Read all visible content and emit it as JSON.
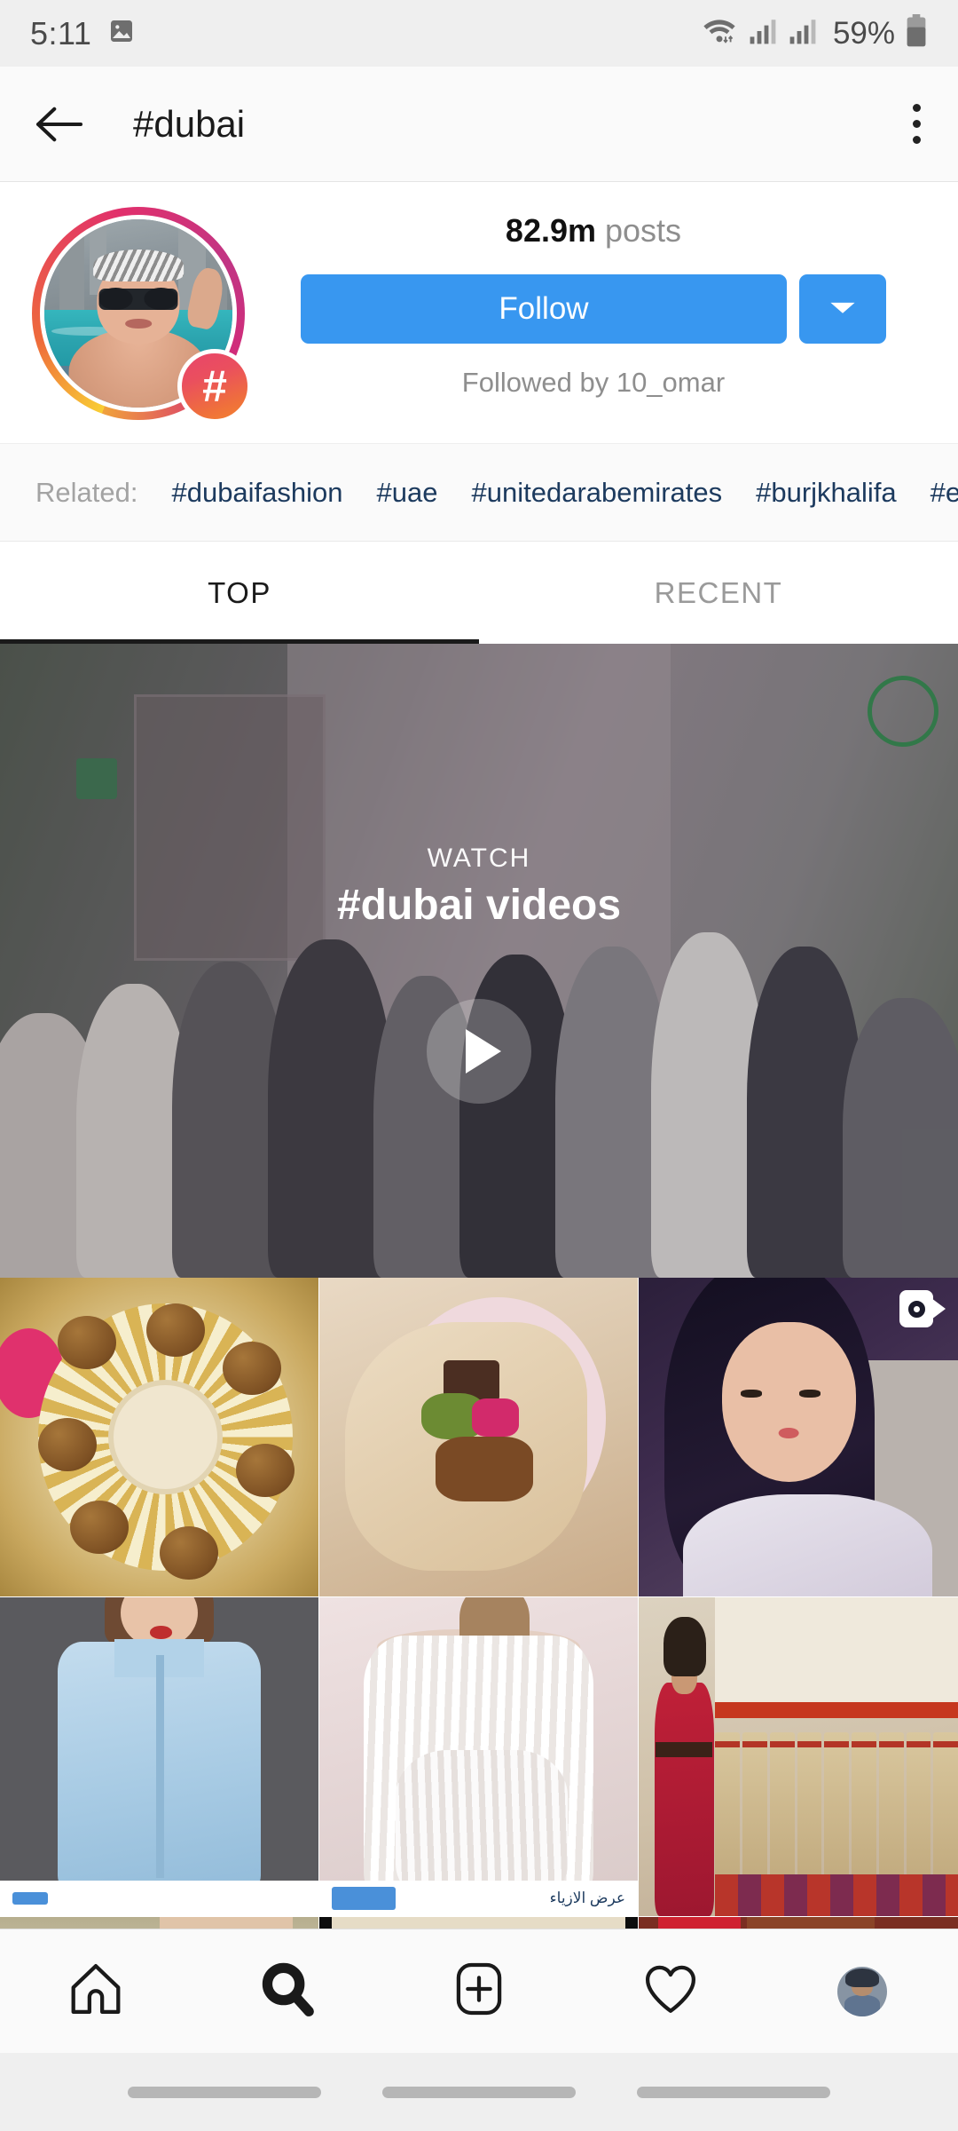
{
  "status_bar": {
    "time": "5:11",
    "battery_percent": "59%",
    "icons": [
      "image-icon",
      "wifi-icon",
      "signal-icon",
      "signal-icon",
      "battery-icon"
    ]
  },
  "header": {
    "title": "#dubai",
    "back_icon": "back-arrow-icon",
    "menu_icon": "kebab-menu-icon"
  },
  "profile": {
    "posts_count": "82.9m",
    "posts_label": "posts",
    "follow_label": "Follow",
    "dropdown_icon": "chevron-down-icon",
    "followed_by": "Followed by 10_omar",
    "hashtag_badge": "#",
    "accent_color": "#3897f0"
  },
  "related": {
    "label": "Related:",
    "tags": [
      "#dubaifashion",
      "#uae",
      "#unitedarabemirates",
      "#burjkhalifa",
      "#emirates",
      "#"
    ]
  },
  "tabs": {
    "items": [
      {
        "label": "TOP",
        "active": true
      },
      {
        "label": "RECENT",
        "active": false
      }
    ]
  },
  "video_banner": {
    "eyebrow": "WATCH",
    "title": "#dubai videos",
    "play_icon": "play-icon"
  },
  "grid": {
    "row1": [
      {
        "alt": "falafel-plate-with-tahini",
        "badge": null
      },
      {
        "alt": "shawarma-wrap-on-plate",
        "badge": null
      },
      {
        "alt": "woman-dark-hair-portrait",
        "badge": "video-camera-icon"
      }
    ],
    "row2": [
      {
        "alt": "model-in-blue-shirt",
        "badge": null
      },
      {
        "alt": "white-draped-dress",
        "badge": null
      },
      {
        "alt": "woman-red-dress-at-spice-souk",
        "badge": null
      }
    ],
    "row2_ads": [
      {
        "button": "ad-button",
        "text": ""
      },
      {
        "button": "ad-button",
        "text": "عرض الازياء"
      },
      {
        "button": null,
        "text": ""
      }
    ],
    "row3_partial": [
      {
        "alt": "partial-post-1"
      },
      {
        "alt": "partial-post-2"
      },
      {
        "alt": "partial-post-3"
      }
    ]
  },
  "bottom_nav": {
    "items": [
      {
        "icon": "home-icon",
        "active": false
      },
      {
        "icon": "search-icon",
        "active": true
      },
      {
        "icon": "add-post-icon",
        "active": false
      },
      {
        "icon": "heart-icon",
        "active": false
      },
      {
        "icon": "profile-avatar-icon",
        "active": false
      }
    ]
  },
  "gesture_bar": {
    "pills": [
      "recents-pill",
      "home-pill",
      "back-pill"
    ]
  }
}
